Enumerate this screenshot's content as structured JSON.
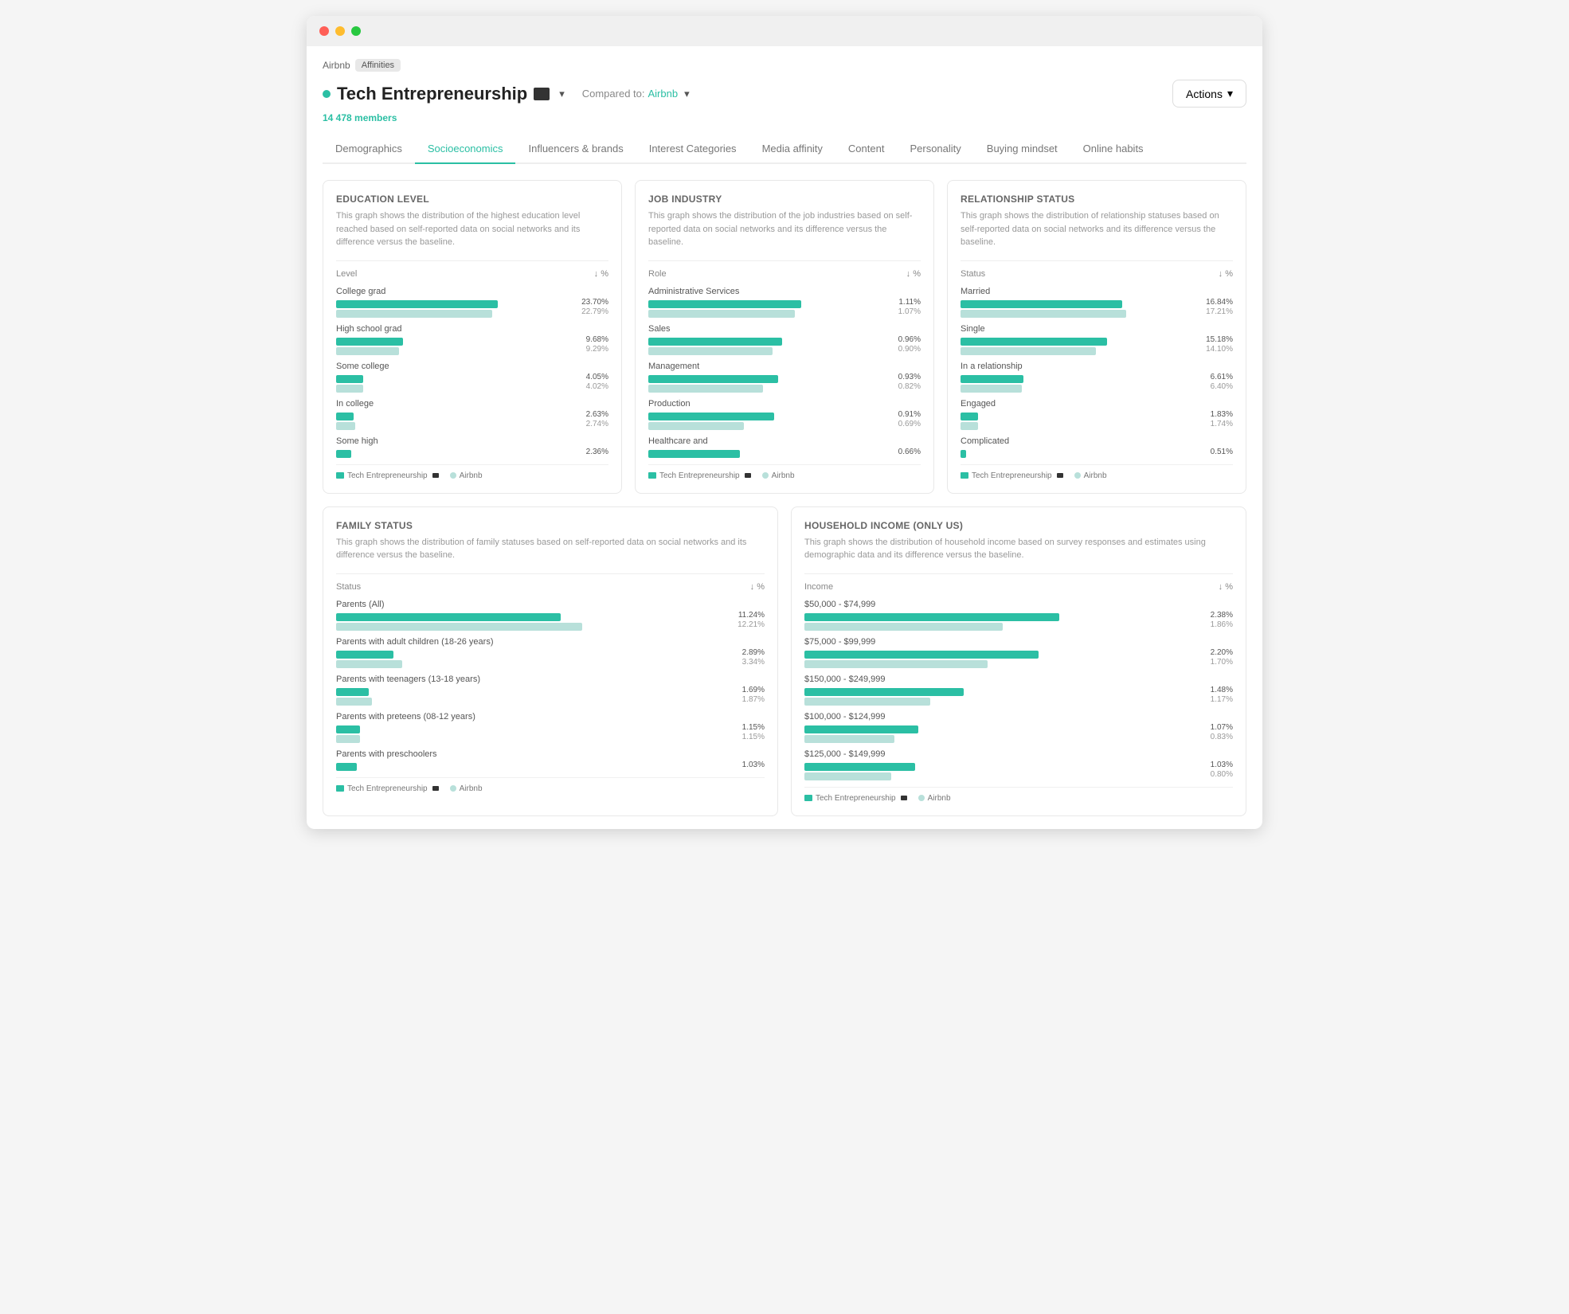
{
  "window": {
    "breadcrumb": {
      "app": "Airbnb",
      "tag": "Affinities"
    },
    "title": "Tech Entrepreneurship",
    "members": "14 478 members",
    "compared_to": "Compared to:",
    "compared_link": "Airbnb",
    "actions_label": "Actions"
  },
  "tabs": [
    {
      "id": "demographics",
      "label": "Demographics",
      "active": false
    },
    {
      "id": "socioeconomics",
      "label": "Socioeconomics",
      "active": true
    },
    {
      "id": "influencers",
      "label": "Influencers & brands",
      "active": false
    },
    {
      "id": "interest",
      "label": "Interest Categories",
      "active": false
    },
    {
      "id": "media",
      "label": "Media affinity",
      "active": false
    },
    {
      "id": "content",
      "label": "Content",
      "active": false
    },
    {
      "id": "personality",
      "label": "Personality",
      "active": false
    },
    {
      "id": "buying",
      "label": "Buying mindset",
      "active": false
    },
    {
      "id": "online",
      "label": "Online habits",
      "active": false
    }
  ],
  "charts": {
    "education": {
      "title": "Education level",
      "desc": "This graph shows the distribution of the highest education level reached based on self-reported data on social networks and its difference versus the baseline.",
      "col1": "Level",
      "col2": "%",
      "rows": [
        {
          "label": "College grad",
          "v1": 23.7,
          "w1": 85,
          "v2": 22.79,
          "w2": 82
        },
        {
          "label": "High school grad",
          "v1": 9.68,
          "w1": 35,
          "v2": 9.29,
          "w2": 33
        },
        {
          "label": "Some college",
          "v1": 4.05,
          "w1": 14,
          "v2": 4.02,
          "w2": 14
        },
        {
          "label": "In college",
          "v1": 2.63,
          "w1": 9,
          "v2": 2.74,
          "w2": 10
        },
        {
          "label": "Some high",
          "v1": 2.36,
          "w1": 8,
          "v2": null,
          "w2": null
        }
      ],
      "legend1": "Tech Entrepreneurship",
      "legend2": "Airbnb"
    },
    "job": {
      "title": "Job industry",
      "desc": "This graph shows the distribution of the job industries based on self-reported data on social networks and its difference versus the baseline.",
      "col1": "Role",
      "col2": "%",
      "rows": [
        {
          "label": "Administrative Services",
          "v1": 1.11,
          "w1": 80,
          "v2": 1.07,
          "w2": 77
        },
        {
          "label": "Sales",
          "v1": 0.96,
          "w1": 70,
          "v2": 0.9,
          "w2": 65
        },
        {
          "label": "Management",
          "v1": 0.93,
          "w1": 68,
          "v2": 0.82,
          "w2": 60
        },
        {
          "label": "Production",
          "v1": 0.91,
          "w1": 66,
          "v2": 0.69,
          "w2": 50
        },
        {
          "label": "Healthcare and",
          "v1": 0.66,
          "w1": 48,
          "v2": null,
          "w2": null
        }
      ],
      "legend1": "Tech Entrepreneurship",
      "legend2": "Airbnb"
    },
    "relationship": {
      "title": "Relationship status",
      "desc": "This graph shows the distribution of relationship statuses based on self-reported data on social networks and its difference versus the baseline.",
      "col1": "Status",
      "col2": "%",
      "rows": [
        {
          "label": "Married",
          "v1": 16.84,
          "w1": 85,
          "v2": 17.21,
          "w2": 87
        },
        {
          "label": "Single",
          "v1": 15.18,
          "w1": 77,
          "v2": 14.1,
          "w2": 71
        },
        {
          "label": "In a relationship",
          "v1": 6.61,
          "w1": 33,
          "v2": 6.4,
          "w2": 32
        },
        {
          "label": "Engaged",
          "v1": 1.83,
          "w1": 9,
          "v2": 1.74,
          "w2": 9
        },
        {
          "label": "Complicated",
          "v1": 0.51,
          "w1": 3,
          "v2": null,
          "w2": null
        }
      ],
      "legend1": "Tech Entrepreneurship",
      "legend2": "Airbnb"
    },
    "family": {
      "title": "Family status",
      "desc": "This graph shows the distribution of family statuses based on self-reported data on social networks and its difference versus the baseline.",
      "col1": "Status",
      "col2": "%",
      "rows": [
        {
          "label": "Parents (All)",
          "v1": 11.24,
          "w1": 75,
          "v2": 12.21,
          "w2": 82
        },
        {
          "label": "Parents with adult children (18-26 years)",
          "v1": 2.89,
          "w1": 19,
          "v2": 3.34,
          "w2": 22
        },
        {
          "label": "Parents with teenagers (13-18 years)",
          "v1": 1.69,
          "w1": 11,
          "v2": 1.87,
          "w2": 12
        },
        {
          "label": "Parents with preteens (08-12 years)",
          "v1": 1.15,
          "w1": 8,
          "v2": 1.15,
          "w2": 8
        },
        {
          "label": "Parents with preschoolers",
          "v1": 1.03,
          "w1": 7,
          "v2": null,
          "w2": null
        }
      ],
      "legend1": "Tech Entrepreneurship",
      "legend2": "Airbnb"
    },
    "income": {
      "title": "Household income (only US)",
      "desc": "This graph shows the distribution of household income based on survey responses and estimates using demographic data and its difference versus the baseline.",
      "col1": "Income",
      "col2": "%",
      "rows": [
        {
          "label": "$50,000 - $74,999",
          "v1": 2.38,
          "w1": 85,
          "v2": 1.86,
          "w2": 66
        },
        {
          "label": "$75,000 - $99,999",
          "v1": 2.2,
          "w1": 78,
          "v2": 1.7,
          "w2": 61
        },
        {
          "label": "$150,000 - $249,999",
          "v1": 1.48,
          "w1": 53,
          "v2": 1.17,
          "w2": 42
        },
        {
          "label": "$100,000 - $124,999",
          "v1": 1.07,
          "w1": 38,
          "v2": 0.83,
          "w2": 30
        },
        {
          "label": "$125,000 - $149,999",
          "v1": 1.03,
          "w1": 37,
          "v2": 0.8,
          "w2": 29
        }
      ],
      "legend1": "Tech Entrepreneurship",
      "legend2": "Airbnb"
    }
  }
}
